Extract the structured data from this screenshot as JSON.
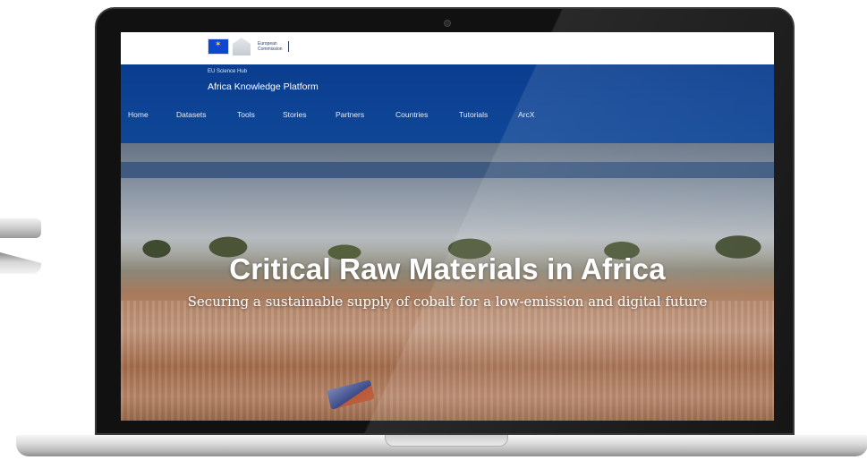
{
  "ec_logo": {
    "line1": "European",
    "line2": "Commission"
  },
  "site": {
    "hub_label": "EU Science Hub",
    "title": "Africa Knowledge Platform"
  },
  "nav": {
    "items": [
      {
        "label": "Home"
      },
      {
        "label": "Datasets"
      },
      {
        "label": "Tools"
      },
      {
        "label": "Stories"
      },
      {
        "label": "Partners"
      },
      {
        "label": "Countries"
      },
      {
        "label": "Tutorials"
      },
      {
        "label": "ArcX"
      }
    ]
  },
  "hero": {
    "title": "Critical Raw Materials in Africa",
    "subtitle": "Securing a sustainable supply of cobalt for a low-emission and digital future"
  },
  "colors": {
    "header_blue": "#0d4394",
    "nav_strip": "#3e5a80",
    "ec_flag": "#0e47cb"
  }
}
